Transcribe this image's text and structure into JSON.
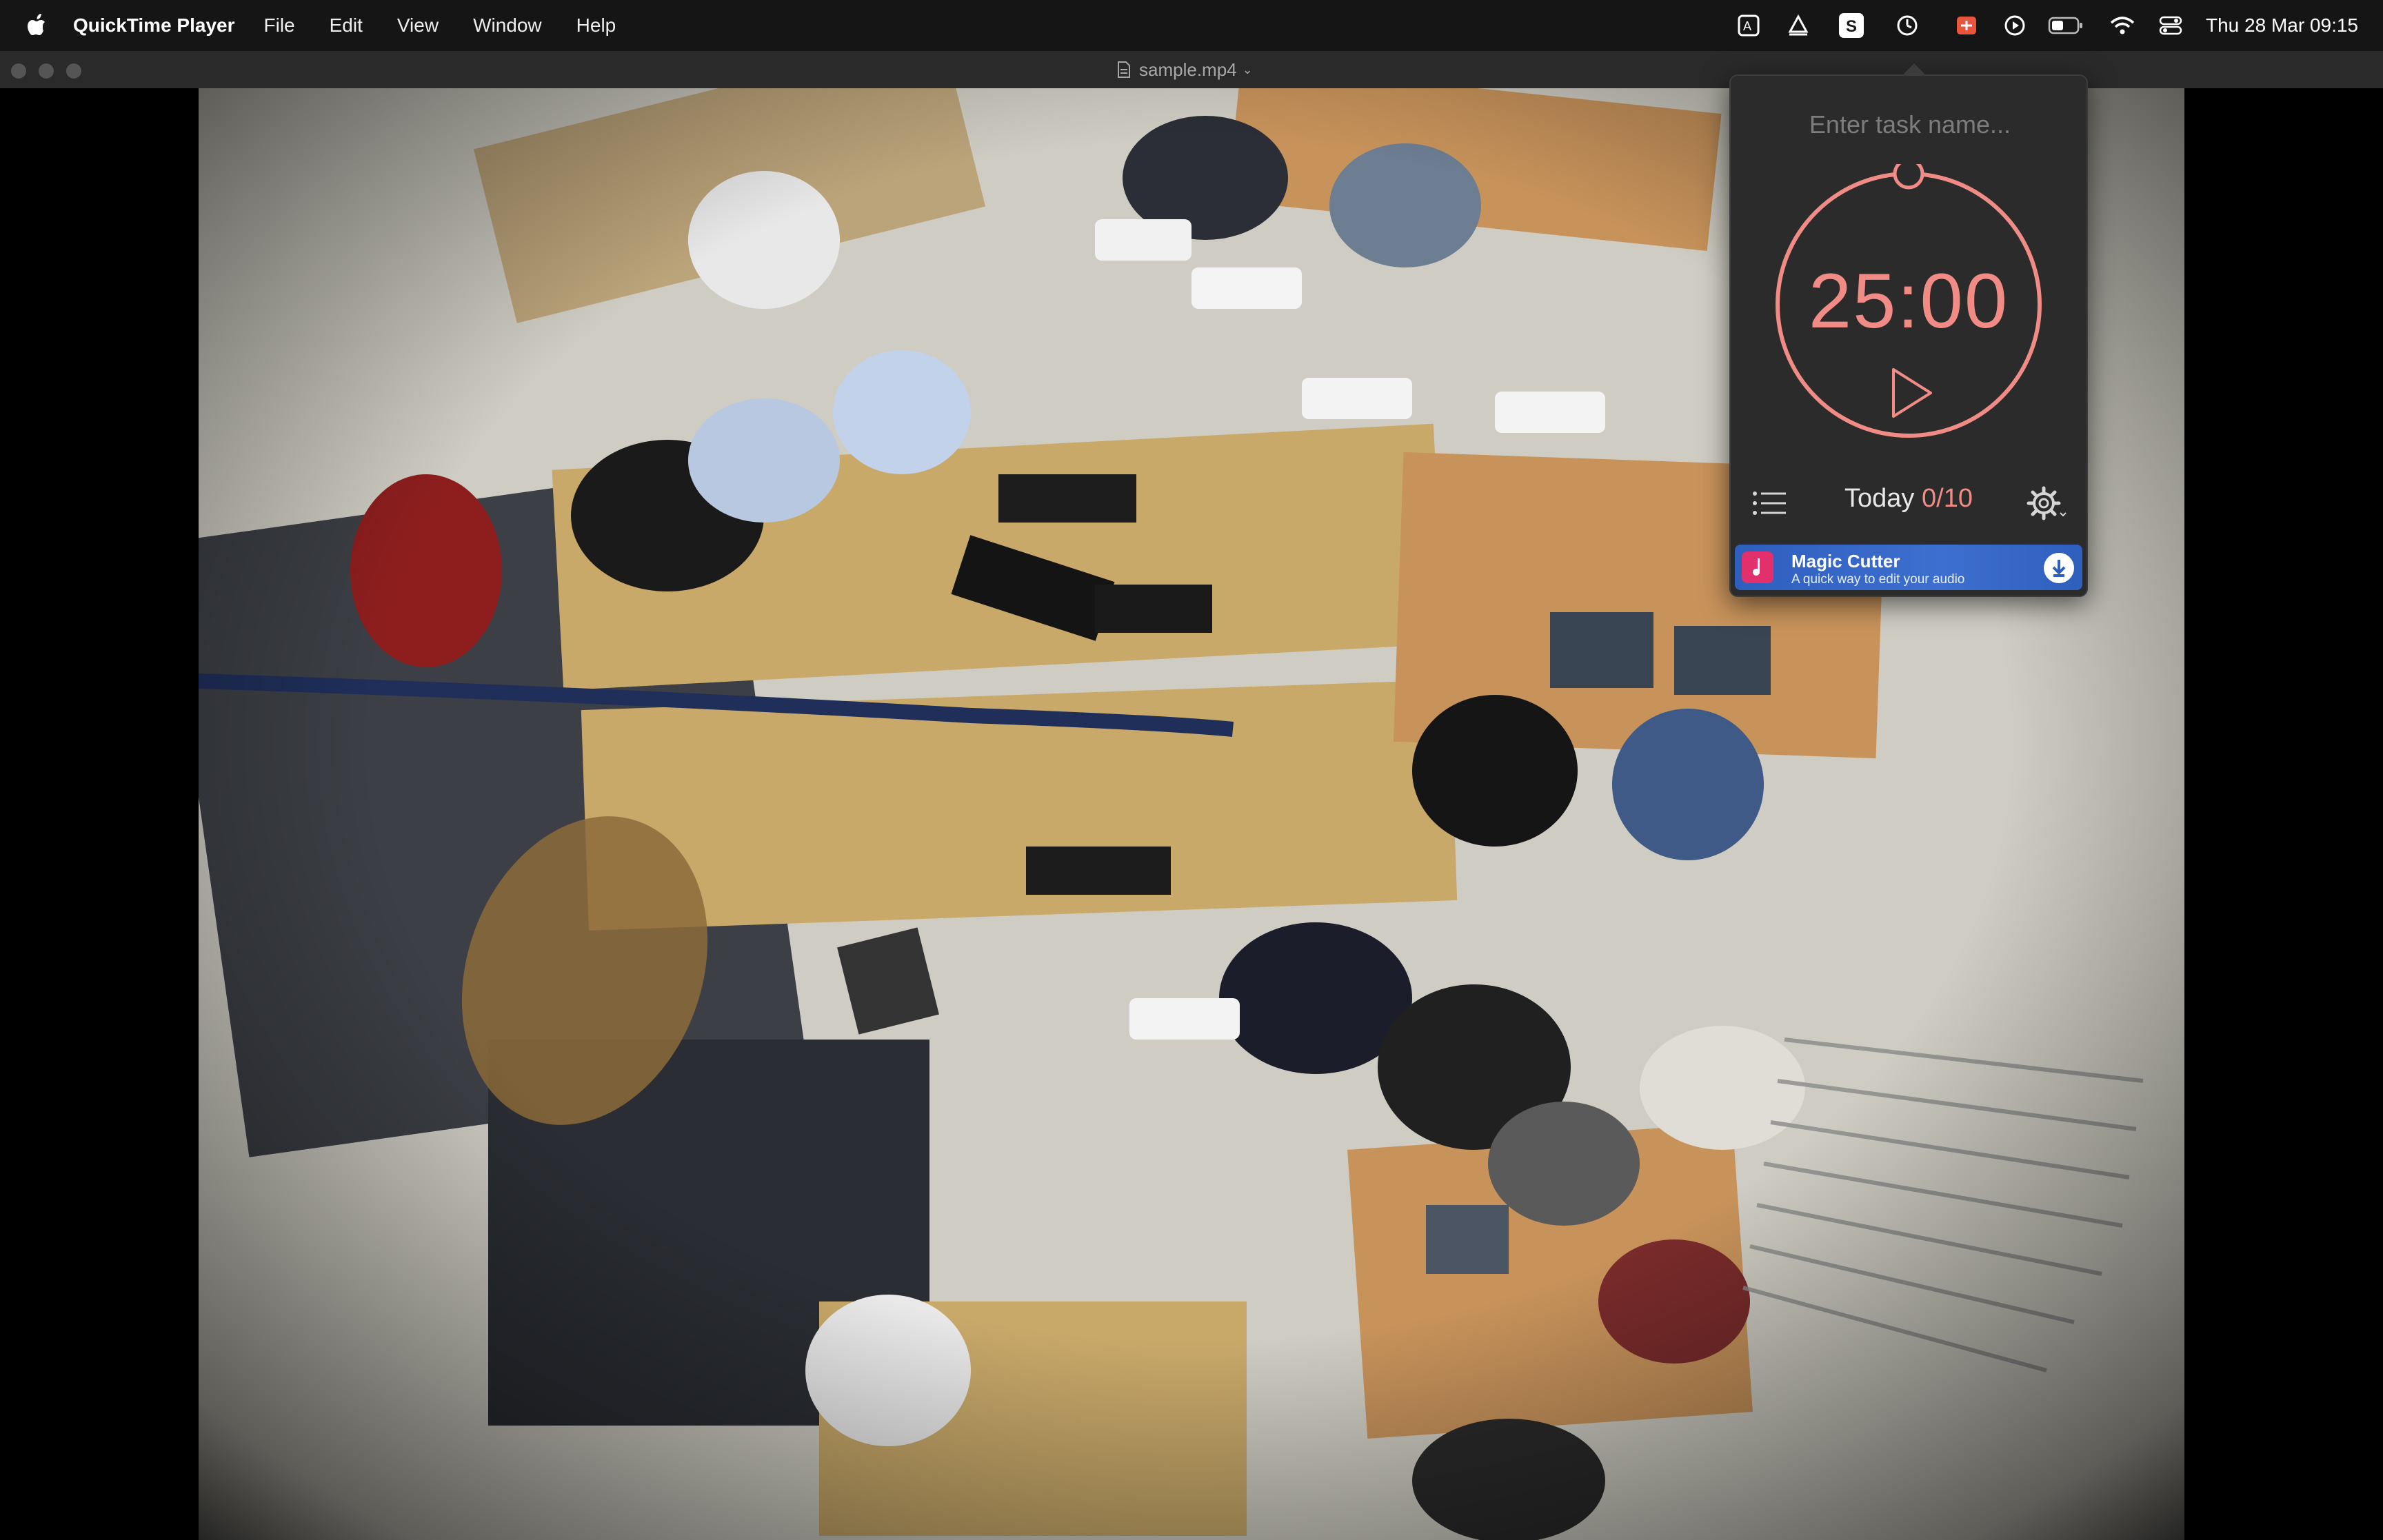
{
  "menubar": {
    "app_name": "QuickTime Player",
    "menus": [
      "File",
      "Edit",
      "View",
      "Window",
      "Help"
    ],
    "status_icons": [
      "translate-icon",
      "cast-icon",
      "s-app-icon",
      "timer-icon",
      "toggle-app-icon",
      "play-circle-icon",
      "battery-icon",
      "wifi-icon",
      "control-center-icon"
    ],
    "clock": "Thu 28 Mar  09:15"
  },
  "window": {
    "title": "sample.mp4",
    "content": "fisheye-video-frame"
  },
  "timer": {
    "task_placeholder": "Enter task name...",
    "time": "25:00",
    "today_label": "Today",
    "today_count": "0/10",
    "accent_color": "#f08c85"
  },
  "ad": {
    "title": "Magic Cutter",
    "subtitle": "A quick way to edit your audio"
  }
}
